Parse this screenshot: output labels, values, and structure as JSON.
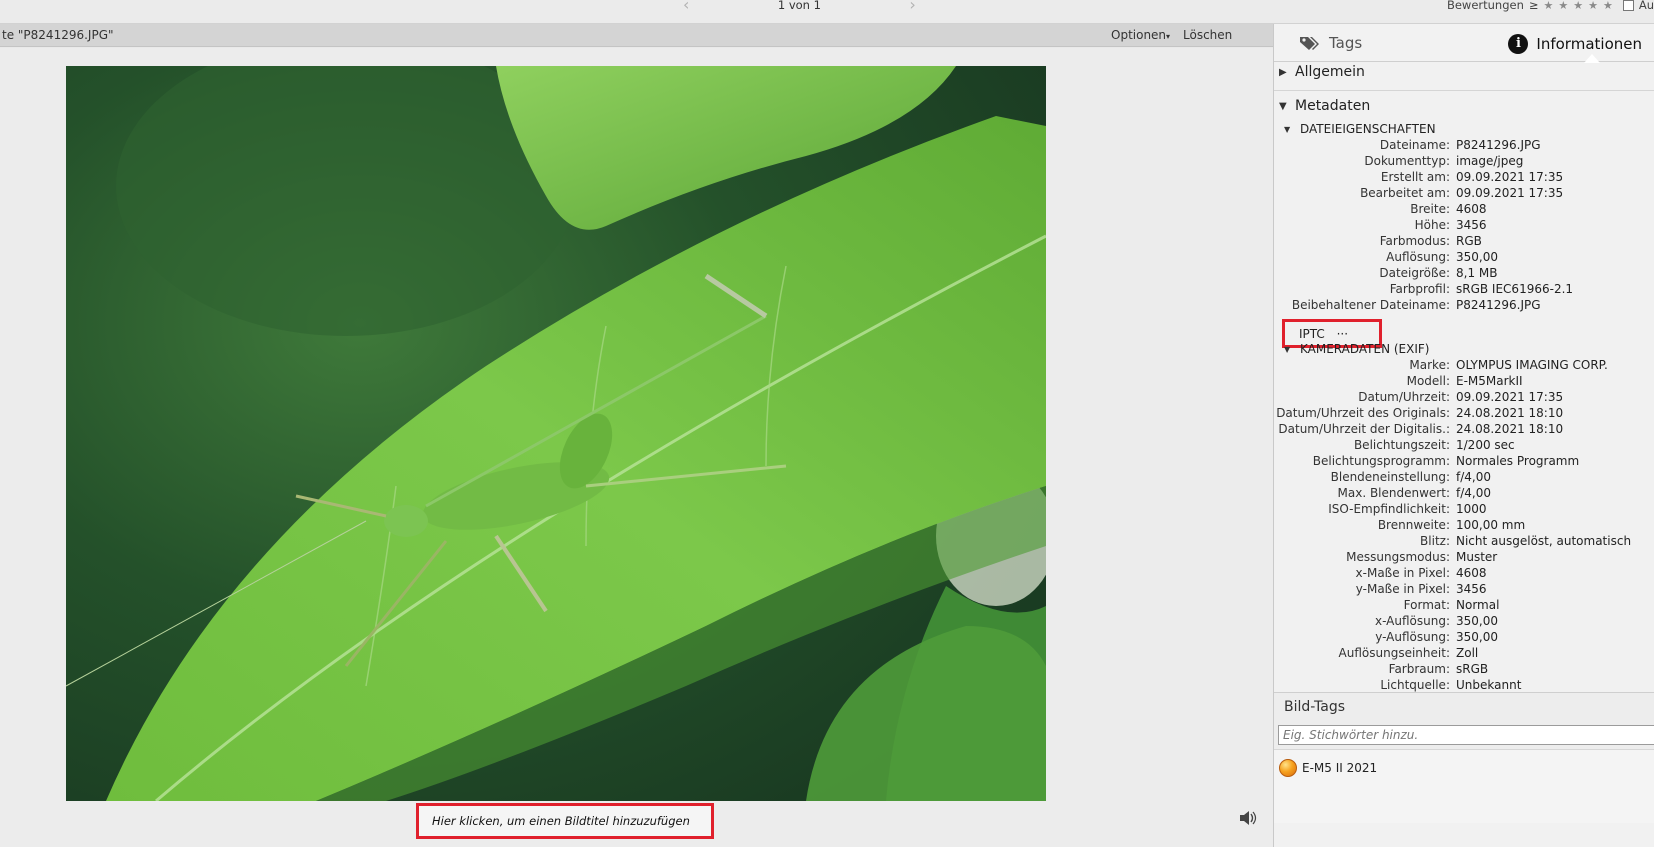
{
  "topbar": {
    "prev_icon": "chevron-left-icon",
    "next_icon": "chevron-right-icon",
    "pager_text": "1 von 1",
    "ratings_label": "Bewertungen",
    "ratings_op": "≥",
    "stars": "★★★★★",
    "auto_label": "Au"
  },
  "docbar": {
    "title": "te \"P8241296.JPG\"",
    "options_label": "Optionen",
    "options_arrow": "▾",
    "delete_label": "Löschen"
  },
  "viewer": {
    "caption_placeholder": "Hier klicken, um einen Bildtitel hinzuzufügen",
    "speaker_icon": "speaker-icon"
  },
  "panel": {
    "tabs": {
      "tags": "Tags",
      "info": "Informationen",
      "info_glyph": "i"
    },
    "sections": {
      "allgemein": "Allgemein",
      "metadaten": "Metadaten"
    },
    "file_props_title": "DATEIEIGENSCHAFTEN",
    "file_props": [
      {
        "label": "Dateiname:",
        "value": "P8241296.JPG"
      },
      {
        "label": "Dokumenttyp:",
        "value": "image/jpeg"
      },
      {
        "label": "Erstellt am:",
        "value": "09.09.2021 17:35"
      },
      {
        "label": "Bearbeitet am:",
        "value": "09.09.2021 17:35"
      },
      {
        "label": "Breite:",
        "value": "4608"
      },
      {
        "label": "Höhe:",
        "value": "3456"
      },
      {
        "label": "Farbmodus:",
        "value": "RGB"
      },
      {
        "label": "Auflösung:",
        "value": "350,00"
      },
      {
        "label": "Dateigröße:",
        "value": "8,1 MB"
      },
      {
        "label": "Farbprofil:",
        "value": "sRGB IEC61966-2.1"
      },
      {
        "label": "Beibehaltener Dateiname:",
        "value": "P8241296.JPG"
      }
    ],
    "iptc_label": "IPTC",
    "iptc_more": "···",
    "camera_title": "KAMERADATEN (EXIF)",
    "camera": [
      {
        "label": "Marke:",
        "value": "OLYMPUS IMAGING CORP."
      },
      {
        "label": "Modell:",
        "value": "E-M5MarkII"
      },
      {
        "label": "Datum/Uhrzeit:",
        "value": "09.09.2021 17:35"
      },
      {
        "label": "Datum/Uhrzeit des Originals:",
        "value": "24.08.2021 18:10"
      },
      {
        "label": "Datum/Uhrzeit der Digitalis.:",
        "value": "24.08.2021 18:10"
      },
      {
        "label": "Belichtungszeit:",
        "value": "1/200 sec"
      },
      {
        "label": "Belichtungsprogramm:",
        "value": "Normales Programm"
      },
      {
        "label": "Blendeneinstellung:",
        "value": "f/4,00"
      },
      {
        "label": "Max. Blendenwert:",
        "value": "f/4,00"
      },
      {
        "label": "ISO-Empfindlichkeit:",
        "value": "1000"
      },
      {
        "label": "Brennweite:",
        "value": "100,00 mm"
      },
      {
        "label": "Blitz:",
        "value": "Nicht ausgelöst, automatisch"
      },
      {
        "label": "Messungsmodus:",
        "value": "Muster"
      },
      {
        "label": "x-Maße in Pixel:",
        "value": "4608"
      },
      {
        "label": "y-Maße in Pixel:",
        "value": "3456"
      },
      {
        "label": "Format:",
        "value": "Normal"
      },
      {
        "label": "x-Auflösung:",
        "value": "350,00"
      },
      {
        "label": "y-Auflösung:",
        "value": "350,00"
      },
      {
        "label": "Auflösungseinheit:",
        "value": "Zoll"
      },
      {
        "label": "Farbraum:",
        "value": "sRGB"
      },
      {
        "label": "Lichtquelle:",
        "value": "Unbekannt"
      }
    ],
    "bildtags": {
      "title": "Bild-Tags",
      "input_placeholder": "Eig. Stichwörter hinzu.",
      "tags": [
        "E-M5 II 2021"
      ]
    }
  },
  "colors": {
    "highlight_red": "#e0202c",
    "leaf_green": "#6cbf3c"
  }
}
